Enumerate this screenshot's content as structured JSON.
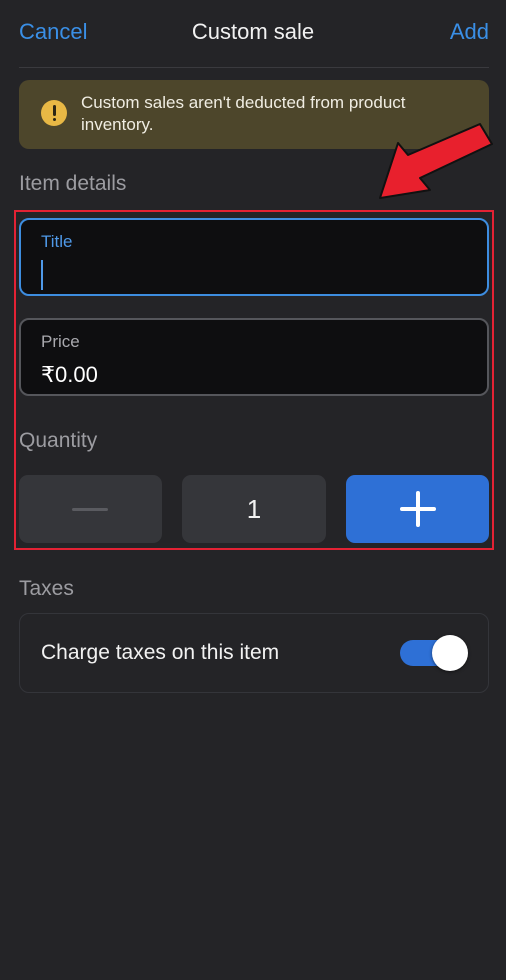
{
  "header": {
    "cancel_label": "Cancel",
    "title": "Custom sale",
    "add_label": "Add"
  },
  "banner": {
    "icon": "alert-icon",
    "text": "Custom sales aren't deducted from product inventory."
  },
  "item_details": {
    "section_label": "Item details",
    "title_field": {
      "label": "Title",
      "value": ""
    },
    "price_field": {
      "label": "Price",
      "value": "₹0.00"
    }
  },
  "quantity": {
    "section_label": "Quantity",
    "value": "1"
  },
  "taxes": {
    "section_label": "Taxes",
    "charge_label": "Charge taxes on this item",
    "charge_enabled": true
  },
  "colors": {
    "accent": "#3a8fe6",
    "background": "#242427",
    "warning_bg": "#4d462b",
    "highlight": "#e32234"
  }
}
